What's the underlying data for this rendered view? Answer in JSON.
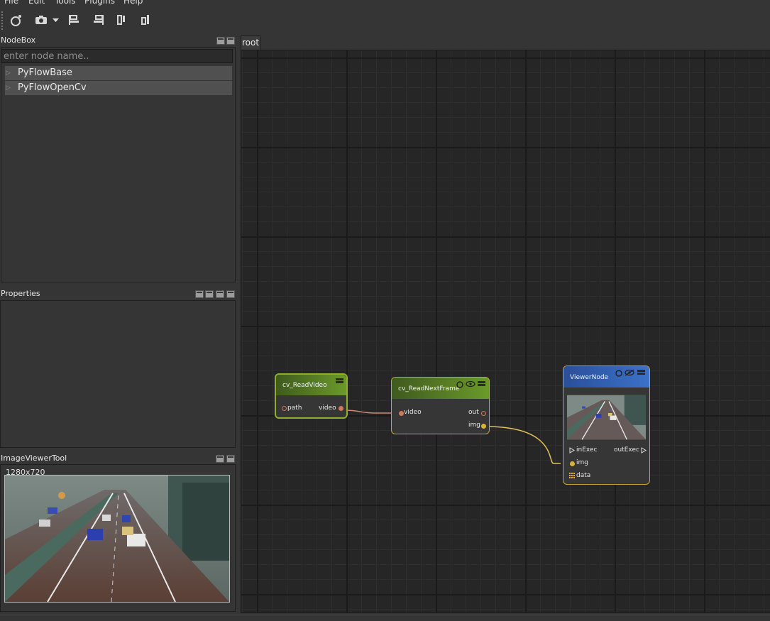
{
  "menu": [
    "File",
    "Edit",
    "Tools",
    "Plugins",
    "Help"
  ],
  "toolbar": {
    "icons": [
      "screenshot-tool-icon",
      "camera-icon",
      "dropdown-arrow-icon",
      "align-left-icon",
      "align-right-icon",
      "align-top-icon",
      "align-bottom-icon"
    ]
  },
  "nodebox": {
    "title": "NodeBox",
    "search_placeholder": "enter node name..",
    "items": [
      "PyFlowBase",
      "PyFlowOpenCv"
    ]
  },
  "properties": {
    "title": "Properties"
  },
  "image_viewer": {
    "title": "ImageViewerTool",
    "resolution": "1280x720"
  },
  "canvas": {
    "tab": "root"
  },
  "nodes": {
    "read_video": {
      "title": "cv_ReadVideo",
      "in_pin": "path",
      "out_pin": "video",
      "header_color": "#5c8f2a"
    },
    "read_next_frame": {
      "title": "cv_ReadNextFrame",
      "in_pin": "video",
      "out_pin_1": "out",
      "out_pin_2": "img",
      "header_color": "#5c8f2a"
    },
    "viewer": {
      "title": "ViewerNode",
      "in_exec": "inExec",
      "out_exec": "outExec",
      "img_pin": "img",
      "data_pin": "data",
      "header_color": "#2f63b8"
    }
  },
  "colors": {
    "selection_border": "#c9a23a",
    "wire_video": "#c98a73",
    "wire_img": "#e3c15a",
    "canvas_bg": "#262626"
  }
}
